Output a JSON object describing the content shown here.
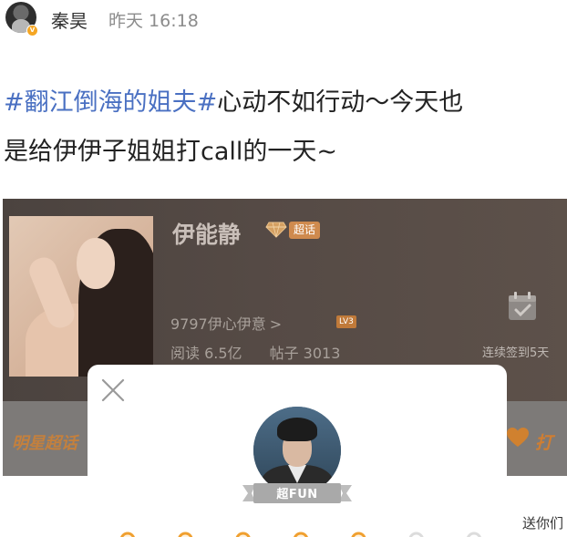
{
  "post": {
    "author": "秦昊",
    "timestamp": "昨天 16:18",
    "hashtag": "#翻江倒海的姐夫#",
    "text_line1_rest": "心动不如行动～今天也",
    "text_line2": "是给伊伊子姐姐打call的一天~"
  },
  "topic_card": {
    "name": "伊能静",
    "tag": "超话",
    "fan_group": "9797伊心伊意",
    "fan_chevron": ">",
    "level": "LV3",
    "reads_label": "阅读",
    "reads_value": "6.5亿",
    "posts_label": "帖子",
    "posts_value": "3013",
    "checkin_status": "连续签到5天"
  },
  "tab_bar": {
    "left_label": "明星超话",
    "right_label": "打"
  },
  "popup": {
    "ribbon_label": "超FUN",
    "progress_filled_dots": 5,
    "progress_total_dots": 7
  },
  "watermark": "送你们",
  "colors": {
    "hashtag": "#4a70c2",
    "accent_orange": "#f0a030",
    "card_bg": "#554a45"
  }
}
